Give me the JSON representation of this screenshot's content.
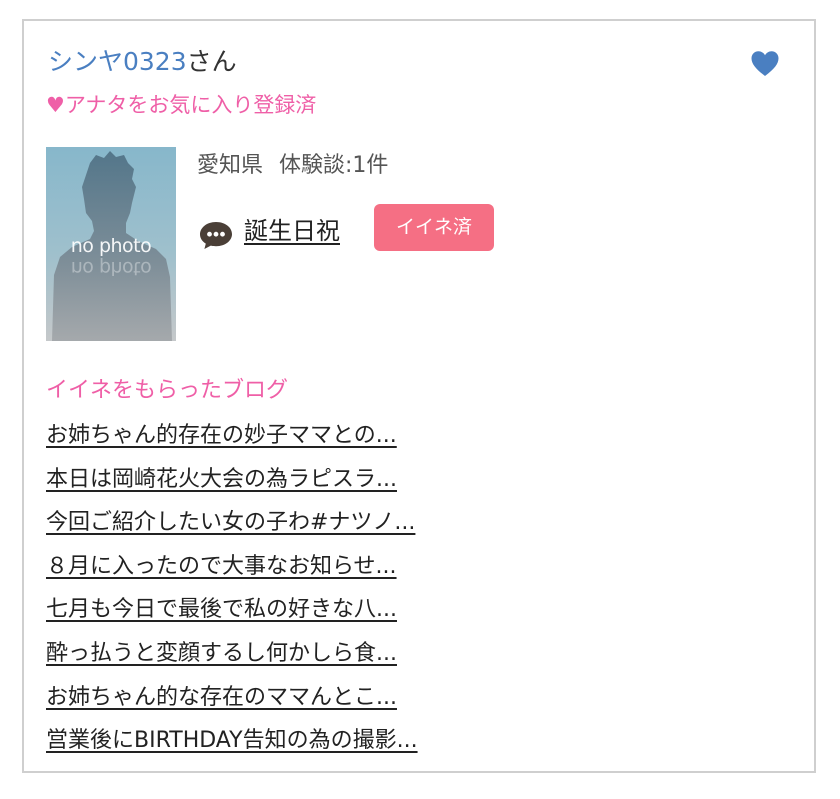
{
  "user": {
    "name": "シンヤ0323",
    "suffix": "さん",
    "favorite_status": "♥アナタをお気に入り登録済",
    "heart_color": "#4a7fc1"
  },
  "photo": {
    "placeholder_text": "no photo"
  },
  "profile": {
    "prefecture": "愛知県",
    "review_count": "体験談:1件"
  },
  "review": {
    "icon": "speech-bubble-icon",
    "title": "誕生日祝",
    "like_badge": "イイネ済",
    "badge_color": "#f56f84"
  },
  "blogs": {
    "section_title": "イイネをもらったブログ",
    "items": [
      "お姉ちゃん的存在の妙子ママとの...",
      "本日は岡崎花火大会の為ラピスラ...",
      "今回ご紹介したい女の子わ#ナツノ...",
      "８月に入ったので大事なお知らせ...",
      "七月も今日で最後で私の好きな八...",
      "酔っ払うと変顔するし何かしら食...",
      "お姉ちゃん的な存在のママんとこ...",
      "営業後にBIRTHDAY告知の為の撮影..."
    ]
  },
  "colors": {
    "accent_pink": "#ef5fa7",
    "link_blue": "#4a7fc1"
  }
}
